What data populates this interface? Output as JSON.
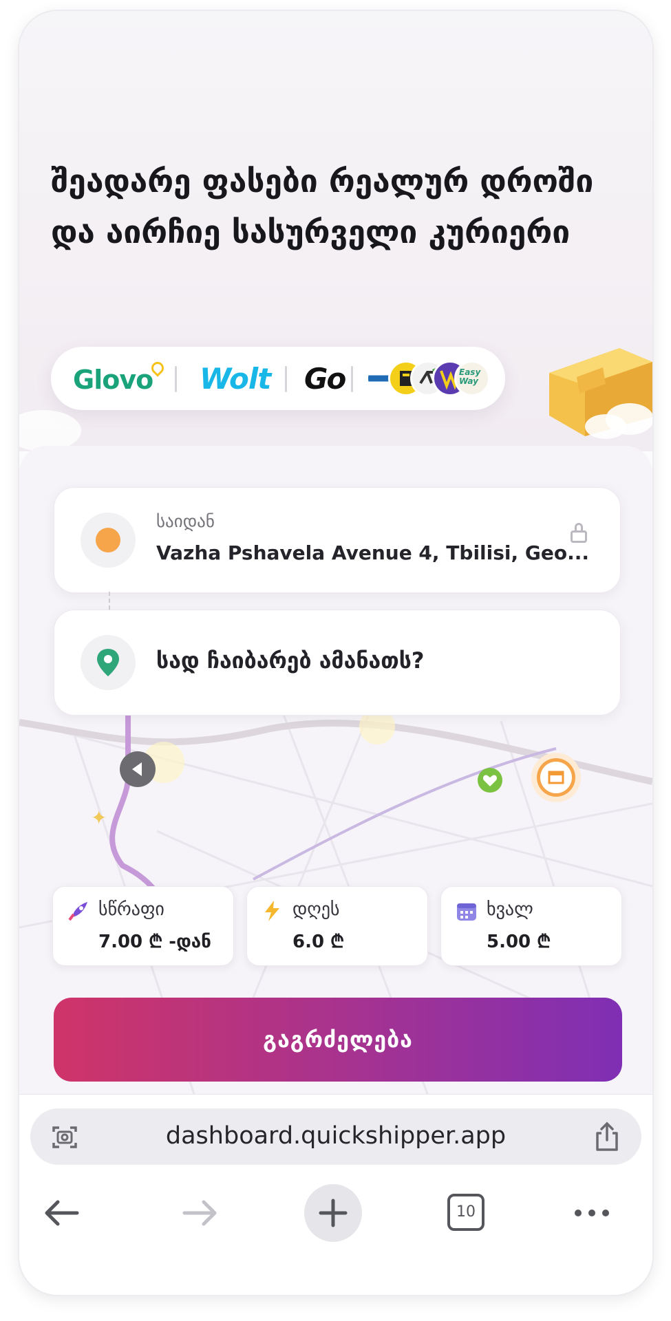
{
  "headline": "შეადარე ფასები რეალურ დროში და აირჩიე სასურველი კურიერი",
  "couriers": {
    "glovo": "Glovo",
    "wolt": "Wolt",
    "go": "Go",
    "easyway": "Easy Way"
  },
  "pickup": {
    "label": "საიდან",
    "value": "Vazha Pshavela Avenue 4, Tbilisi, Geo..."
  },
  "dropoff": {
    "placeholder": "სად ჩაიბარებ ამანათს?"
  },
  "delivery_options": [
    {
      "label": "სწრაფი",
      "price": "7.00 ₾ -დან",
      "icon": "rocket-icon"
    },
    {
      "label": "დღეს",
      "price": "6.0 ₾",
      "icon": "lightning-icon"
    },
    {
      "label": "ხვალ",
      "price": "5.00 ₾",
      "icon": "calendar-icon"
    }
  ],
  "continue_label": "გაგრძელება",
  "browser": {
    "url": "dashboard.quickshipper.app",
    "tab_count": "10"
  },
  "colors": {
    "accent_start": "#cf3468",
    "accent_end": "#7f2fb4",
    "pickup_dot": "#f7a54a",
    "dropoff_pin": "#2fa57a"
  }
}
